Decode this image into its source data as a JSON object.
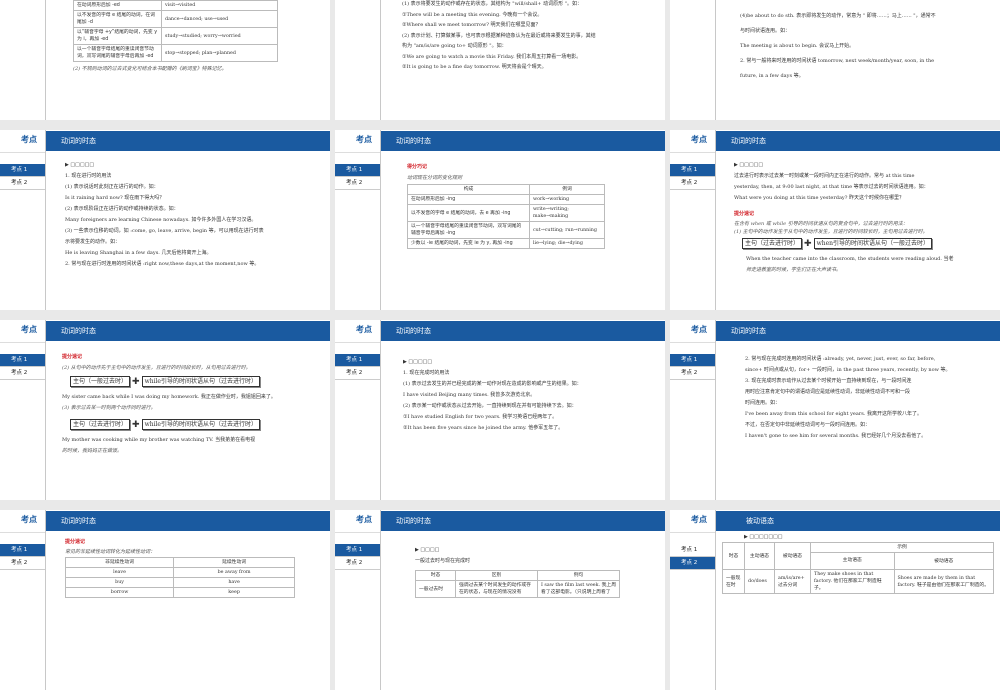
{
  "common": {
    "side_title": "考点",
    "item1": "考点 1",
    "item2": "考点 2",
    "tense_title": "动词的时态",
    "passive_title": "被动语态",
    "arrow": "▶ □□□□□"
  },
  "s0": {
    "rows": [
      [
        "在动词原形后加 -ed",
        "visit→visited"
      ],
      [
        "以不发音的字母 e 结尾的动词，在词尾加 -d",
        "dance→danced; use→used"
      ],
      [
        "以“辅音字母 +y”结尾的动词，先变 y 为 i，再加 -ed",
        "study→studied; worry→worried"
      ],
      [
        "以一个辅音字母结尾的重读闭音节动词，双写词尾的辅音字母后再加 -ed",
        "stop→stopped; plan→planned"
      ]
    ],
    "note": "(2) 不规则动词的过去式变化可结合本书配赠的《刷词宝》特殊记忆。"
  },
  "s1": {
    "lines": [
      "(1) 表示将要发生的动作或存在的状态，其结构为 \"will/shall+ 动词原形 \"。如：",
      "①There will be a meeting this evening. 今晚有一个会议。",
      "②Where shall we meet tomorrow? 明天我们在哪里见面？",
      "(2) 表示计划、打算做某事，也可表示根据某种迹象认为在最近或将来要发生的事，其结",
      "构为 \"am/is/are going to+ 动词原形 \"。如：",
      "①We are going to watch a movie this Friday. 我们本周五打算看一场电影。",
      "②It is going to be a fine day tomorrow. 明天将会是个晴天。"
    ]
  },
  "s2": {
    "lines": [
      "(4)be about to do sth. 表示即将发生的动作，常意为 \" 即将……；马上…… \"，通常不",
      "与时间状语连用。如：",
      "The meeting is about to begin. 会议马上开始。",
      "2. 常与一般将来时连用的时间状语 tomorrow, next week/month/year, soon, in the",
      "future, in a few days 等。"
    ]
  },
  "s3": {
    "lines": [
      "1. 现在进行时的用法",
      "(1) 表示说话时此刻正在进行的动作。如：",
      "Is it raining hard now? 现在雨下得大吗？",
      "(2) 表示现阶段正在进行的动作或持续的状态。如：",
      "Many foreigners are learning Chinese nowadays. 如今许多外国人在学习汉语。",
      "(3) 一些表示位移的动词，如 :come, go, leave, arrive, begin 等，可以用现在进行时表",
      "示将要发生的动作。如：",
      "He is leaving Shanghai in a few days. 几天后他将离开上海。",
      "2. 常与现在进行时连用的时间状语 :right now,these days,at the moment,now 等。"
    ]
  },
  "s4": {
    "tip": "得分巧记",
    "caption": "动词现在分词的变化规则",
    "headers": [
      "构成",
      "例词"
    ],
    "rows": [
      [
        "在动词原形后加 -ing",
        "work→working"
      ],
      [
        "以不发音的字母 e 结尾的动词，去 e 再加 -ing",
        "write→writing; make→making"
      ],
      [
        "以一个辅音字母结尾的重读闭音节动词，双写词尾的辅音字母后再加 -ing",
        "cut→cutting; run→running"
      ],
      [
        "少数以 -ie 结尾的动词，先变 ie 为 y, 再加 -ing",
        "lie→lying; die→dying"
      ]
    ]
  },
  "s5": {
    "lines": [
      "过去进行时表示过去某一时刻或某一段时间内正在进行的动作。常与 at this time",
      "yesterday, then, at 9:00 last night, at that time 等表示过去的时间状语连用。如：",
      "What were you doing at this time yesterday? 昨天这个时候你在哪里？"
    ],
    "tip": "提分速记",
    "note1": "在含有 when 或 while 引导的时间状语从句的复合句中，过去进行时的用法：",
    "note2": "(1) 主句中的动作发生于从句中的动作发生，且进行的时间较长时，主句用过去进行时。",
    "box1": "主句（过去进行时）",
    "box2": "when引导的时间状语从句（一般过去时）",
    "ex": "When the teacher came into the classroom, the students were reading aloud. 当老",
    "ex2": "师走进教室的时候，学生们正在大声读书。"
  },
  "s6": {
    "tip": "提分速记",
    "note": "(2) 从句中的动作先于主句中的动作发生，且进行的时间段长时，从句用过去进行时。",
    "box1": "主句（一般过去时）",
    "box2": "while引导的时间状语从句（过去进行时）",
    "ex1": "My sister came back while I was doing my homework. 我正在做作业时，我姐姐回来了。",
    "note3": "(3) 表示过去某一时刻两个动作同时进行。",
    "box3": "主句（过去进行时）",
    "box4": "while引导的时间状语从句（过去进行时）",
    "ex2": "My mother was cooking while my brother was watching TV. 当我弟弟在看电视",
    "ex3": "的时候，我妈妈正在做饭。"
  },
  "s7": {
    "lines": [
      "1. 现在完成时的用法",
      "(1) 表示过去发生的并已经完成的某一动作对现在造成的影响或产生的结果。如：",
      "I have visited Beijing many times. 我曾多次游览北京。",
      "(2) 表示某一动作或状态从过去开始，一直持续到现在并有可能持续下去。如：",
      "①I have studied English for two years. 我学习英语已经两年了。",
      "②It has been five years since he joined the army. 他参军五年了。"
    ]
  },
  "s8": {
    "lines": [
      "2. 常与现在完成时连用的时间状语 :already, yet, never, just, ever, so far, before,",
      "since+ 时间点或从句，for+ 一段时间，in the past three years, recently, by now 等。",
      "3. 现在完成时表示动作从过去某个时候开始一直持续到现在，与一段时间连",
      "用时应注意肯定句中的谓语动词应是延续性动词，非延续性动词不可和一段",
      "时间连用。如：",
      "I've been away from this school for eight years. 我离开这所学校八年了。",
      "不过，在否定句中非延续性动词可与一段时间连用。如：",
      "I haven't gone to see him for several months. 我已经好几个月没去看他了。"
    ]
  },
  "s9": {
    "tip": "提分速记",
    "caption": "常见的非延续性动词转化为延续性动词：",
    "headers": [
      "非延续性动词",
      "延续性动词"
    ],
    "rows": [
      [
        "leave",
        "be away from"
      ],
      [
        "buy",
        "have"
      ],
      [
        "borrow",
        "keep"
      ]
    ]
  },
  "s10": {
    "arrow": "▶ □□□□",
    "sub": "一般过去时与现在完成时",
    "headers": [
      "时态",
      "区别",
      "例句"
    ],
    "rows": [
      [
        "一般过去时",
        "强调过去某个时间发生的动作或存在的状态，与现在的情况没有",
        "I saw the film last week. 我上周看了这部电影。（只说明上周看了"
      ]
    ]
  },
  "s11": {
    "arrow": "▶ □□□□□□□",
    "headers": [
      "时态",
      "主动语态",
      "被动语态",
      "示例",
      "主动语态",
      "被动语态"
    ],
    "rows": [
      [
        "一般现在时",
        "do/does",
        "am/is/are+ 过去分词",
        "They make shoes in that factory. 他们在那家工厂制造鞋子。",
        "Shoes are made by them in that factory. 鞋子是由他们在那家工厂制造的。"
      ]
    ]
  }
}
